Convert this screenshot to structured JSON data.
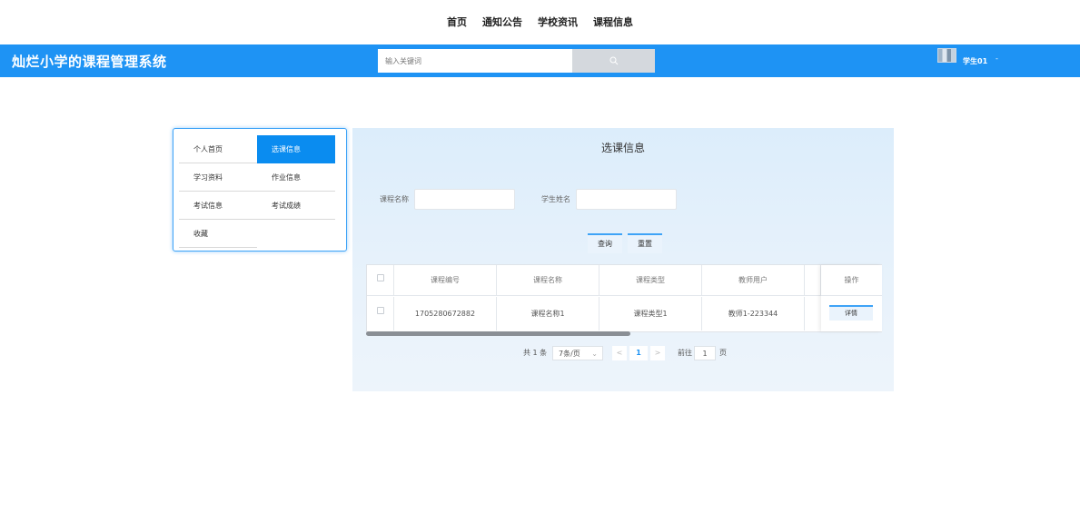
{
  "topnav": {
    "items": [
      "首页",
      "通知公告",
      "学校资讯",
      "课程信息"
    ]
  },
  "header": {
    "brand": "灿烂小学的课程管理系统",
    "search_placeholder": "输入关键词",
    "search_icon": "search-icon",
    "username": "学生01",
    "caret": "-",
    "accent_color": "#1e93f4"
  },
  "sidebar": {
    "items": [
      {
        "label": "个人首页",
        "active": false
      },
      {
        "label": "选课信息",
        "active": true
      },
      {
        "label": "学习资料",
        "active": false
      },
      {
        "label": "作业信息",
        "active": false
      },
      {
        "label": "考试信息",
        "active": false
      },
      {
        "label": "考试成绩",
        "active": false
      },
      {
        "label": "收藏",
        "active": false
      }
    ]
  },
  "main": {
    "title": "选课信息",
    "filters": {
      "course_name_label": "课程名称",
      "student_name_label": "学生姓名"
    },
    "query_button": "查询",
    "reset_button": "重置",
    "table": {
      "columns": [
        "课程编号",
        "课程名称",
        "课程类型",
        "教师用户",
        "操作"
      ],
      "rows": [
        {
          "course_no": "1705280672882",
          "course_name": "课程名称1",
          "course_type": "课程类型1",
          "teacher": "教师1-223344",
          "action": "详情"
        }
      ]
    },
    "pagination": {
      "total": "共 1 条",
      "page_size": "7条/页",
      "prev": "<",
      "current_page": "1",
      "next": ">",
      "goto_label": "前往",
      "goto_value": "1",
      "page_unit": "页"
    }
  }
}
